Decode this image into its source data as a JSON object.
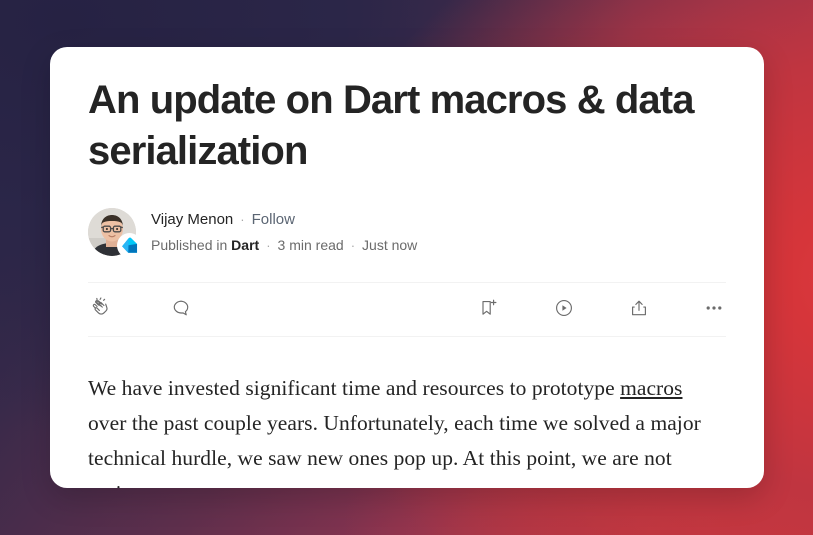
{
  "background": {
    "gradient_from": "#282444",
    "gradient_mid": "#8d3450",
    "gradient_to": "#d23a3c"
  },
  "article": {
    "title": "An update on Dart macros & data serialization",
    "byline": {
      "author": "Vijay Menon",
      "separator": "·",
      "follow_label": "Follow",
      "published_in_label": "Published in",
      "publication": "Dart",
      "read_time": "3 min read",
      "timestamp": "Just now",
      "avatar_alt": "author-avatar-photo",
      "badge_alt": "dart-logo-badge"
    },
    "toolbar": {
      "clap_label": "clap",
      "comment_label": "comment",
      "bookmark_label": "save",
      "listen_label": "listen",
      "share_label": "share",
      "more_label": "more options"
    },
    "body": {
      "part1": "We have invested significant time and resources to prototype ",
      "link": "macros",
      "part2": " over the past couple years. Unfortunately, each time we solved a major technical hurdle, we saw new ones pop up. At this point, we are not seeing macros"
    }
  }
}
